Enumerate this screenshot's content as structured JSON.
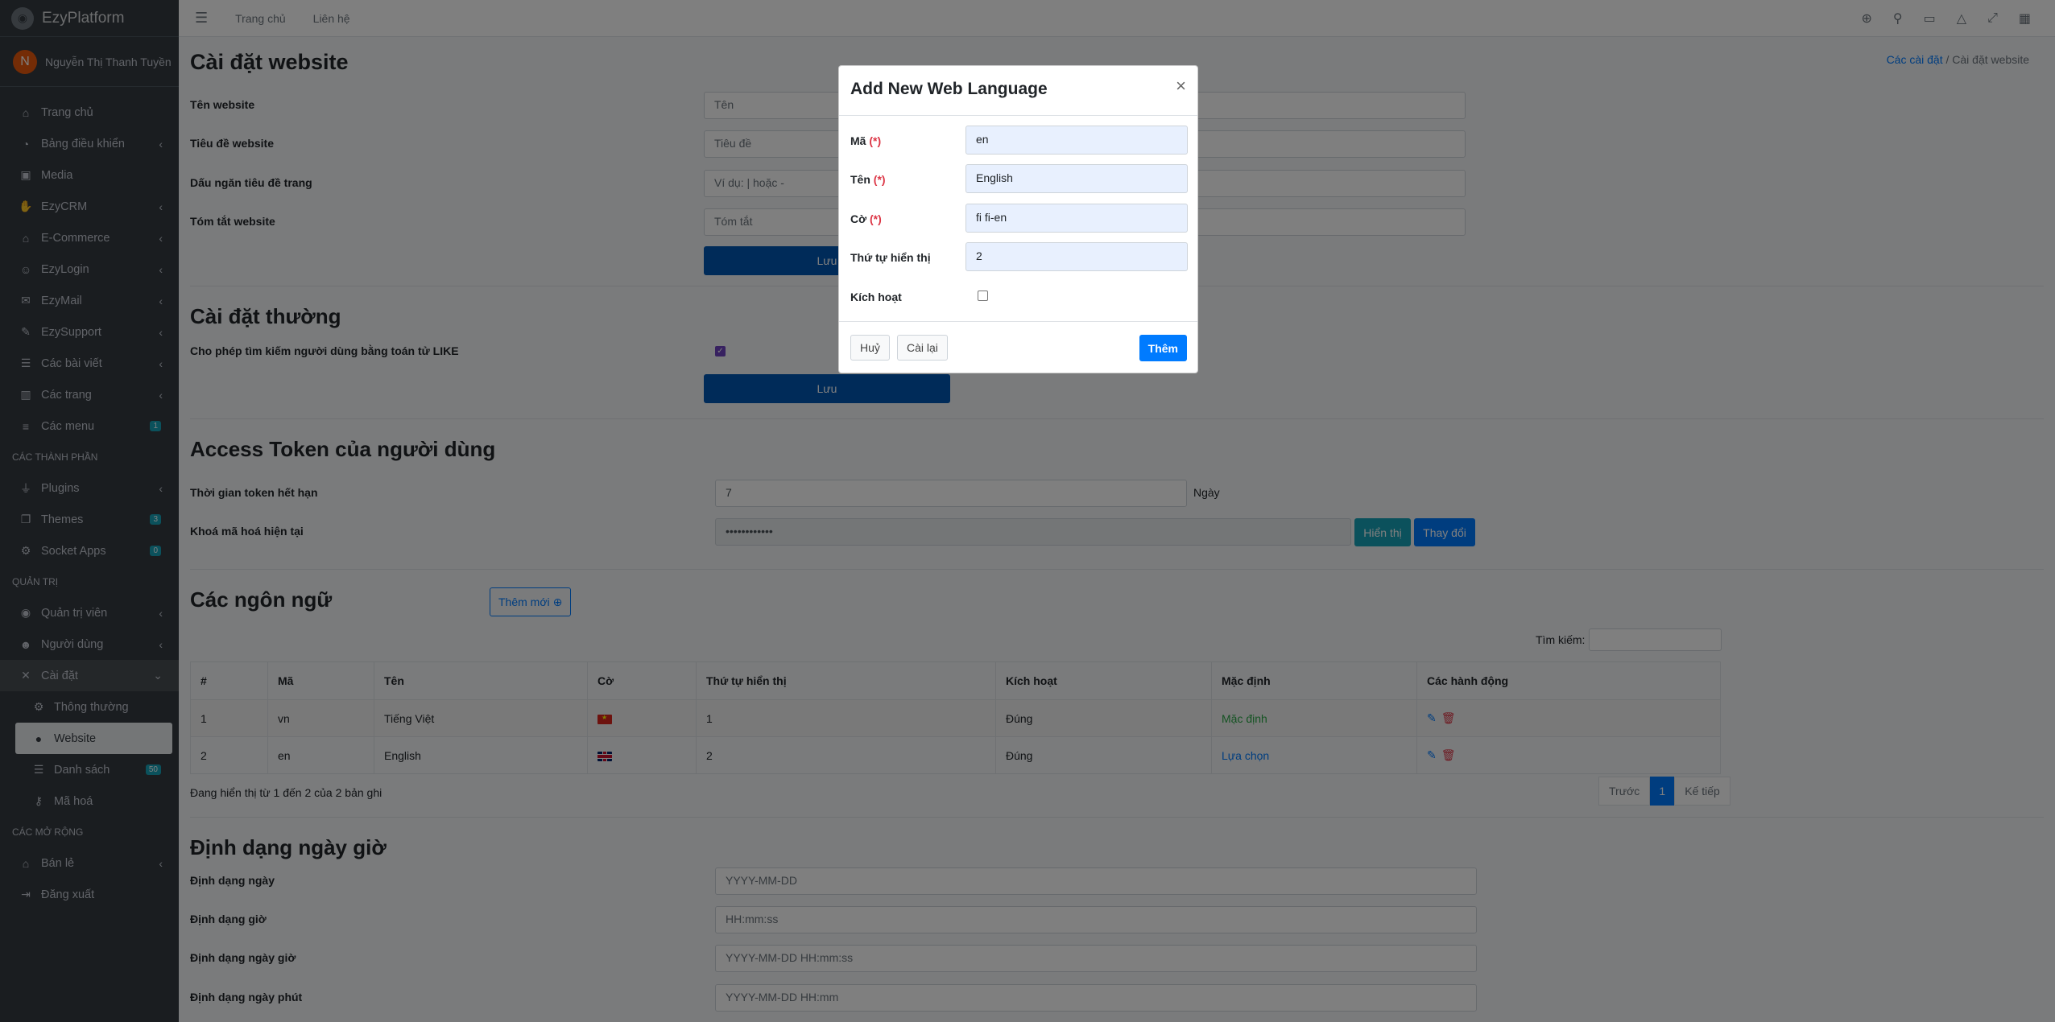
{
  "brand": {
    "title": "EzyPlatform"
  },
  "user": {
    "initial": "N",
    "name": "Nguyễn Thị Thanh Tuyền"
  },
  "sidebar": {
    "items": [
      {
        "label": "Trang chủ"
      },
      {
        "label": "Bảng điều khiển"
      },
      {
        "label": "Media"
      },
      {
        "label": "EzyCRM"
      },
      {
        "label": "E-Commerce"
      },
      {
        "label": "EzyLogin"
      },
      {
        "label": "EzyMail"
      },
      {
        "label": "EzySupport"
      },
      {
        "label": "Các bài viết"
      },
      {
        "label": "Các trang"
      },
      {
        "label": "Các menu",
        "badge": "1"
      }
    ],
    "header_components": "CÁC THÀNH PHẦN",
    "components": [
      {
        "label": "Plugins"
      },
      {
        "label": "Themes",
        "badge": "3"
      },
      {
        "label": "Socket Apps",
        "badge": "0"
      }
    ],
    "header_admin": "QUẢN TRỊ",
    "admin": [
      {
        "label": "Quản trị viên"
      },
      {
        "label": "Người dùng"
      },
      {
        "label": "Cài đặt"
      },
      {
        "label": "Thông thường"
      },
      {
        "label": "Website"
      },
      {
        "label": "Danh sách",
        "badge": "50"
      },
      {
        "label": "Mã hoá"
      }
    ],
    "header_ext": "CÁC MỞ RỘNG",
    "ext": [
      {
        "label": "Bán lẻ"
      },
      {
        "label": "Đăng xuất"
      }
    ]
  },
  "navbar": {
    "home": "Trang chủ",
    "contact": "Liên hệ"
  },
  "page": {
    "title": "Cài đặt website",
    "breadcrumb_parent": "Các cài đặt",
    "breadcrumb_sep": "/",
    "breadcrumb_current": "Cài đặt website"
  },
  "website": {
    "name_label": "Tên website",
    "name_placeholder": "Tên",
    "title_label": "Tiêu đề website",
    "title_placeholder": "Tiêu đề",
    "sep_label": "Dấu ngăn tiêu đề trang",
    "sep_placeholder": "Ví dụ: | hoặc -",
    "summary_label": "Tóm tắt website",
    "summary_placeholder": "Tóm tắt",
    "save": "Lưu"
  },
  "general": {
    "title": "Cài đặt thường",
    "like_label": "Cho phép tìm kiếm người dùng bằng toán tử LIKE",
    "save": "Lưu"
  },
  "token": {
    "title": "Access Token của người dùng",
    "expire_label": "Thời gian token hết hạn",
    "expire_value": "7",
    "expire_unit": "Ngày",
    "key_label": "Khoá mã hoá hiện tại",
    "key_value": "••••••••••••",
    "show": "Hiển thị",
    "change": "Thay đổi"
  },
  "languages": {
    "title": "Các ngôn ngữ",
    "add_new": "Thêm mới",
    "search_label": "Tìm kiếm:",
    "columns": [
      "#",
      "Mã",
      "Tên",
      "Cờ",
      "Thứ tự hiển thị",
      "Kích hoạt",
      "Mặc định",
      "Các hành động"
    ],
    "rows": [
      {
        "no": "1",
        "code": "vn",
        "name": "Tiếng Việt",
        "order": "1",
        "active": "Đúng",
        "default": "Mặc định"
      },
      {
        "no": "2",
        "code": "en",
        "name": "English",
        "order": "2",
        "active": "Đúng",
        "default": "Lựa chọn"
      }
    ],
    "info": "Đang hiển thị từ 1 đến 2 của 2 bản ghi",
    "prev": "Trước",
    "page": "1",
    "next": "Kế tiếp"
  },
  "datetime": {
    "title": "Định dạng ngày giờ",
    "date_label": "Định dạng ngày",
    "date_value": "YYYY-MM-DD",
    "time_label": "Định dạng giờ",
    "time_value": "HH:mm:ss",
    "datetime_label": "Định dạng ngày giờ",
    "datetime_value": "YYYY-MM-DD HH:mm:ss",
    "dateminute_label": "Định dạng ngày phút",
    "dateminute_value": "YYYY-MM-DD HH:mm"
  },
  "modal": {
    "title": "Add New Web Language",
    "close": "×",
    "code_label": "Mã",
    "code_value": "en",
    "name_label": "Tên",
    "name_value": "English",
    "flag_label": "Cờ",
    "flag_value": "fi fi-en",
    "order_label": "Thứ tự hiển thị",
    "order_value": "2",
    "active_label": "Kích hoạt",
    "required_mark": "(*)",
    "cancel": "Huỷ",
    "reset": "Cài lại",
    "submit": "Thêm"
  }
}
